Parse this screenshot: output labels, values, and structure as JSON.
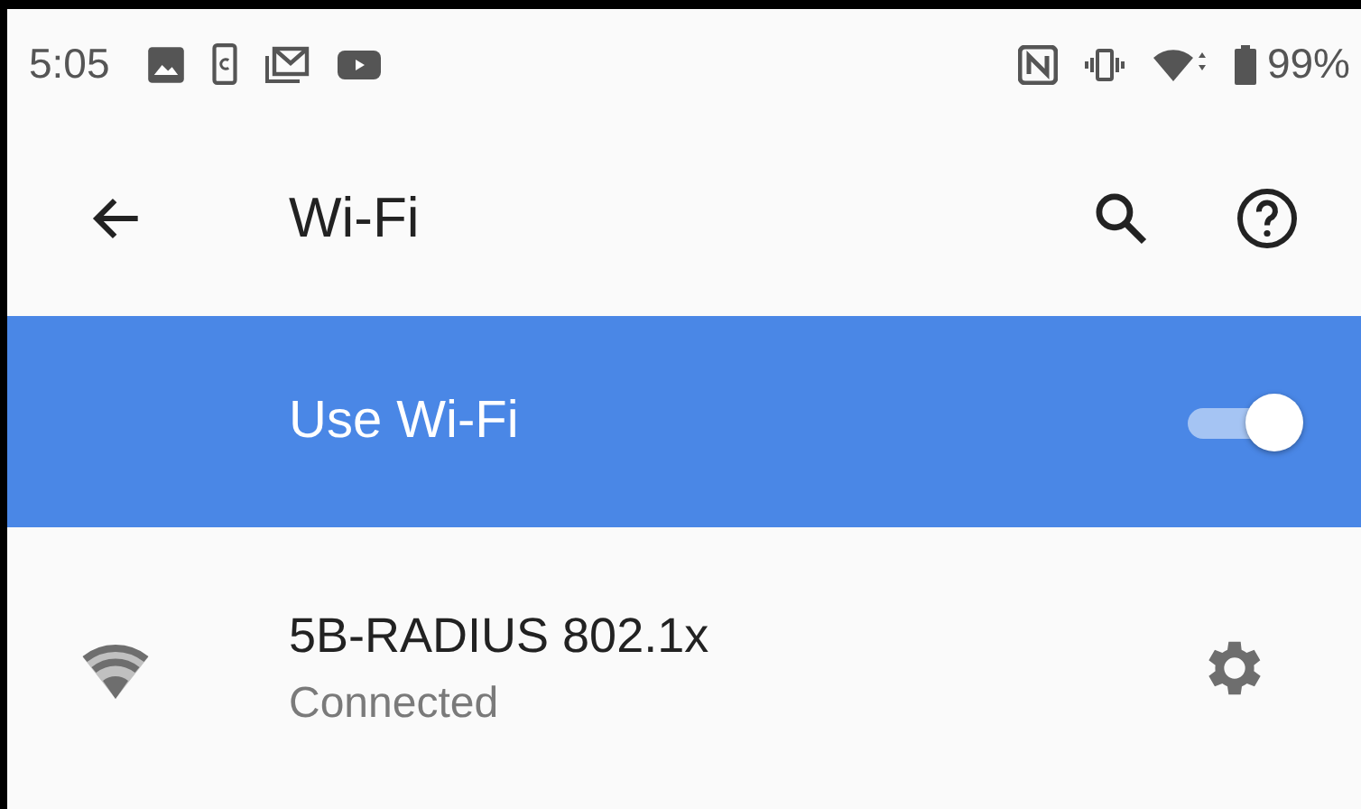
{
  "status_bar": {
    "time": "5:05",
    "battery": "99%"
  },
  "app_bar": {
    "title": "Wi-Fi"
  },
  "master_switch": {
    "label": "Use Wi-Fi",
    "on": true
  },
  "networks": [
    {
      "name": "5B-RADIUS 802.1x",
      "status": "Connected"
    }
  ]
}
